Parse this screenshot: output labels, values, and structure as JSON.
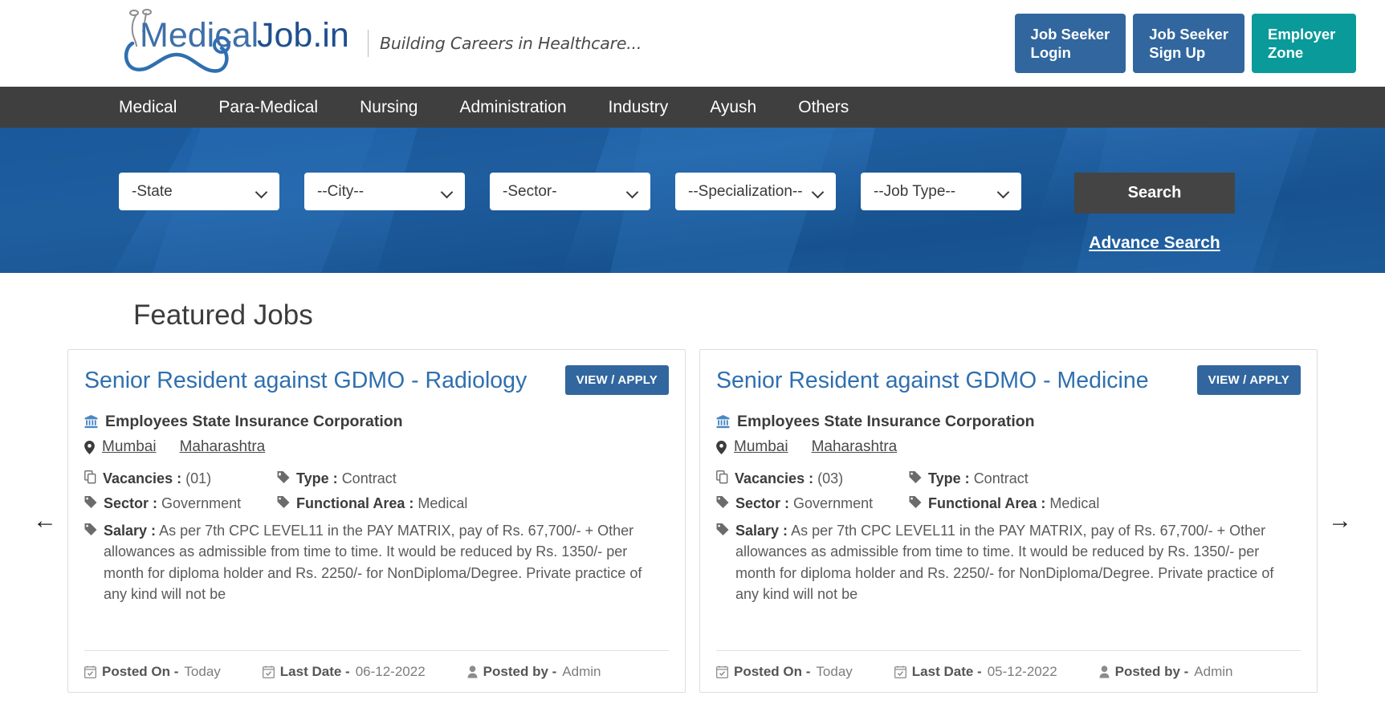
{
  "site": {
    "logo_primary": "Medical",
    "logo_secondary": "Job.in",
    "tagline": "Building Careers in Healthcare...",
    "brand_color": "#31679e",
    "accent_color": "#0b9a9a"
  },
  "header": {
    "buttons": [
      {
        "label": "Job Seeker\nLogin",
        "style": "blue",
        "name": "job-seeker-login-button"
      },
      {
        "label": "Job Seeker\nSign Up",
        "style": "blue",
        "name": "job-seeker-signup-button"
      },
      {
        "label": "Employer\nZone",
        "style": "teal",
        "name": "employer-zone-button"
      }
    ]
  },
  "nav": {
    "items": [
      "Medical",
      "Para-Medical",
      "Nursing",
      "Administration",
      "Industry",
      "Ayush",
      "Others"
    ]
  },
  "search": {
    "filters": [
      {
        "name": "state-select",
        "value": "-State"
      },
      {
        "name": "city-select",
        "value": "--City--"
      },
      {
        "name": "sector-select",
        "value": "-Sector-"
      },
      {
        "name": "specialization-select",
        "value": "--Specialization--"
      },
      {
        "name": "job-type-select",
        "value": "--Job Type--"
      }
    ],
    "search_button": "Search",
    "advance_search": "Advance Search"
  },
  "featured": {
    "title": "Featured Jobs",
    "prev_arrow": "←",
    "next_arrow": "→",
    "labels": {
      "view_apply": "VIEW / APPLY",
      "vacancies": "Vacancies :",
      "type": "Type :",
      "sector": "Sector :",
      "functional_area": "Functional Area :",
      "salary": "Salary :",
      "posted_on": "Posted On -",
      "last_date": "Last Date -",
      "posted_by": "Posted by -"
    },
    "jobs": [
      {
        "title": "Senior Resident against GDMO - Radiology",
        "company": "Employees State Insurance Corporation",
        "city": "Mumbai",
        "state": "Maharashtra",
        "vacancies": "(01)",
        "type": "Contract",
        "sector": "Government",
        "functional_area": "Medical",
        "salary": "As per 7th CPC LEVEL11 in the PAY MATRIX, pay of Rs. 67,700/- + Other allowances as admissible from time to time. It would be reduced by Rs. 1350/- per month for diploma holder and Rs. 2250/- for NonDiploma/Degree. Private practice of any kind will not be",
        "posted_on": "Today",
        "last_date": "06-12-2022",
        "posted_by": "Admin"
      },
      {
        "title": "Senior Resident against GDMO - Medicine",
        "company": "Employees State Insurance Corporation",
        "city": "Mumbai",
        "state": "Maharashtra",
        "vacancies": "(03)",
        "type": "Contract",
        "sector": "Government",
        "functional_area": "Medical",
        "salary": "As per 7th CPC LEVEL11 in the PAY MATRIX, pay of Rs. 67,700/- + Other allowances as admissible from time to time. It would be reduced by Rs. 1350/- per month for diploma holder and Rs. 2250/- for NonDiploma/Degree. Private practice of any kind will not be",
        "posted_on": "Today",
        "last_date": "05-12-2022",
        "posted_by": "Admin"
      }
    ]
  }
}
